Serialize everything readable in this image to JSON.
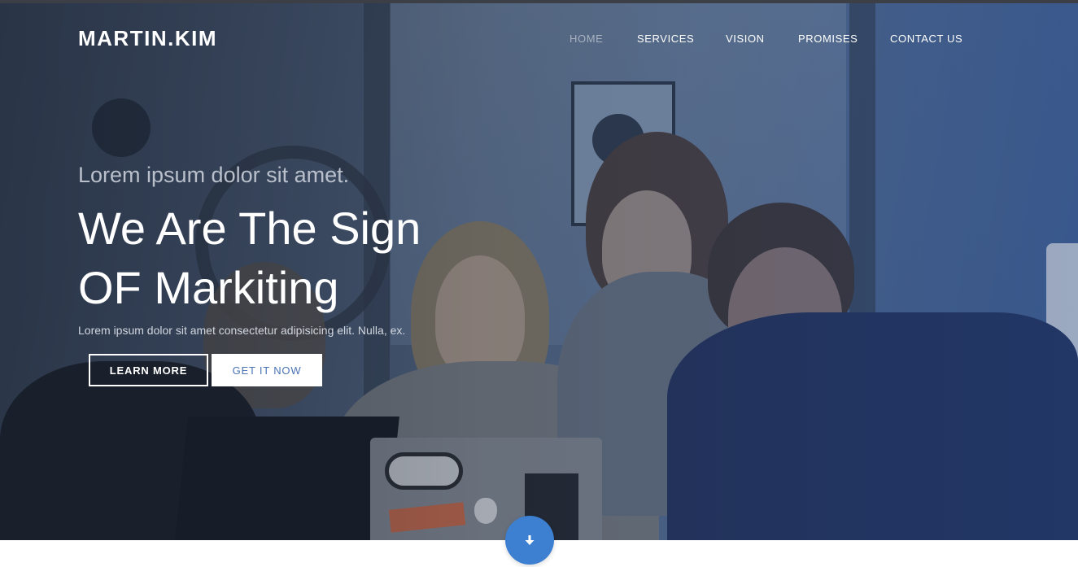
{
  "brand": {
    "name": "MARTIN.KIM"
  },
  "nav": {
    "items": [
      {
        "label": "HOME",
        "active": true
      },
      {
        "label": "SERVICES",
        "active": false
      },
      {
        "label": "VISION",
        "active": false
      },
      {
        "label": "PROMISES",
        "active": false
      },
      {
        "label": "CONTACT US",
        "active": false
      }
    ]
  },
  "hero": {
    "kicker": "Lorem ipsum dolor sit amet.",
    "headline_line1": "We Are The Sign",
    "headline_line2": "OF Markiting",
    "subtext": "Lorem ipsum dolor sit amet consectetur adipisicing elit. Nulla, ex.",
    "buttons": {
      "learn_more": "LEARN MORE",
      "get_it_now": "GET IT NOW"
    },
    "scroll_icon": "arrow-down-icon"
  },
  "colors": {
    "accent": "#3d7fd0",
    "nav_active": "#a9b2bf",
    "button_solid_text": "#4a74b4"
  }
}
